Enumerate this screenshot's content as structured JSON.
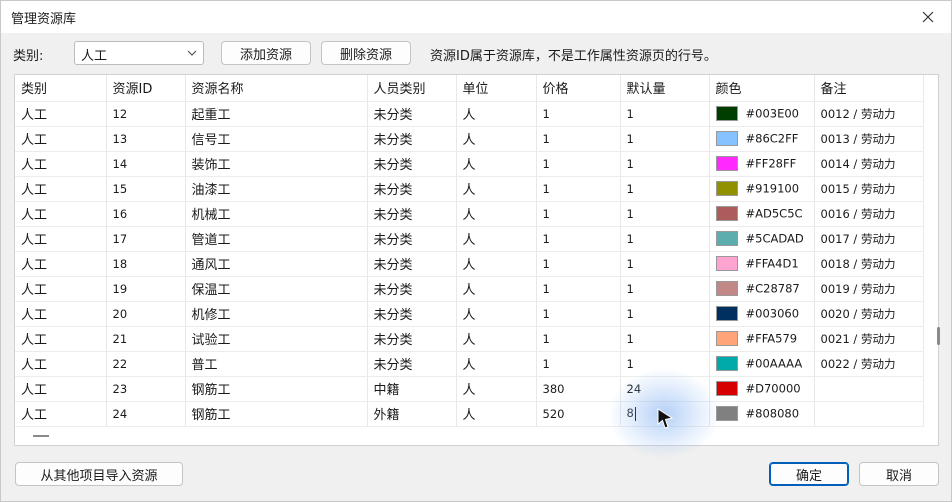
{
  "window": {
    "title": "管理资源库"
  },
  "toolbar": {
    "category_label": "类别:",
    "category_value": "人工",
    "add_label": "添加资源",
    "delete_label": "删除资源",
    "hint": "资源ID属于资源库，不是工作属性资源页的行号。"
  },
  "table": {
    "headers": [
      "类别",
      "资源ID",
      "资源名称",
      "人员类别",
      "单位",
      "价格",
      "默认量",
      "颜色",
      "备注"
    ],
    "rows": [
      {
        "cat": "人工",
        "id": "12",
        "name": "起重工",
        "ptype": "未分类",
        "unit": "人",
        "price": "1",
        "qty": "1",
        "color": "#003E00",
        "note": "0012 / 劳动力"
      },
      {
        "cat": "人工",
        "id": "13",
        "name": "信号工",
        "ptype": "未分类",
        "unit": "人",
        "price": "1",
        "qty": "1",
        "color": "#86C2FF",
        "note": "0013 / 劳动力"
      },
      {
        "cat": "人工",
        "id": "14",
        "name": "装饰工",
        "ptype": "未分类",
        "unit": "人",
        "price": "1",
        "qty": "1",
        "color": "#FF28FF",
        "note": "0014 / 劳动力"
      },
      {
        "cat": "人工",
        "id": "15",
        "name": "油漆工",
        "ptype": "未分类",
        "unit": "人",
        "price": "1",
        "qty": "1",
        "color": "#919100",
        "note": "0015 / 劳动力"
      },
      {
        "cat": "人工",
        "id": "16",
        "name": "机械工",
        "ptype": "未分类",
        "unit": "人",
        "price": "1",
        "qty": "1",
        "color": "#AD5C5C",
        "note": "0016 / 劳动力"
      },
      {
        "cat": "人工",
        "id": "17",
        "name": "管道工",
        "ptype": "未分类",
        "unit": "人",
        "price": "1",
        "qty": "1",
        "color": "#5CADAD",
        "note": "0017 / 劳动力"
      },
      {
        "cat": "人工",
        "id": "18",
        "name": "通风工",
        "ptype": "未分类",
        "unit": "人",
        "price": "1",
        "qty": "1",
        "color": "#FFA4D1",
        "note": "0018 / 劳动力"
      },
      {
        "cat": "人工",
        "id": "19",
        "name": "保温工",
        "ptype": "未分类",
        "unit": "人",
        "price": "1",
        "qty": "1",
        "color": "#C28787",
        "note": "0019 / 劳动力"
      },
      {
        "cat": "人工",
        "id": "20",
        "name": "机修工",
        "ptype": "未分类",
        "unit": "人",
        "price": "1",
        "qty": "1",
        "color": "#003060",
        "note": "0020 / 劳动力"
      },
      {
        "cat": "人工",
        "id": "21",
        "name": "试验工",
        "ptype": "未分类",
        "unit": "人",
        "price": "1",
        "qty": "1",
        "color": "#FFA579",
        "note": "0021 / 劳动力"
      },
      {
        "cat": "人工",
        "id": "22",
        "name": "普工",
        "ptype": "未分类",
        "unit": "人",
        "price": "1",
        "qty": "1",
        "color": "#00AAAA",
        "note": "0022 / 劳动力"
      },
      {
        "cat": "人工",
        "id": "23",
        "name": "钢筋工",
        "ptype": "中籍",
        "unit": "人",
        "price": "380",
        "qty": "24",
        "color": "#D70000",
        "note": ""
      },
      {
        "cat": "人工",
        "id": "24",
        "name": "钢筋工",
        "ptype": "外籍",
        "unit": "人",
        "price": "520",
        "qty": "8",
        "color": "#808080",
        "note": ""
      }
    ]
  },
  "footer": {
    "import_label": "从其他项目导入资源",
    "ok_label": "确定",
    "cancel_label": "取消"
  }
}
